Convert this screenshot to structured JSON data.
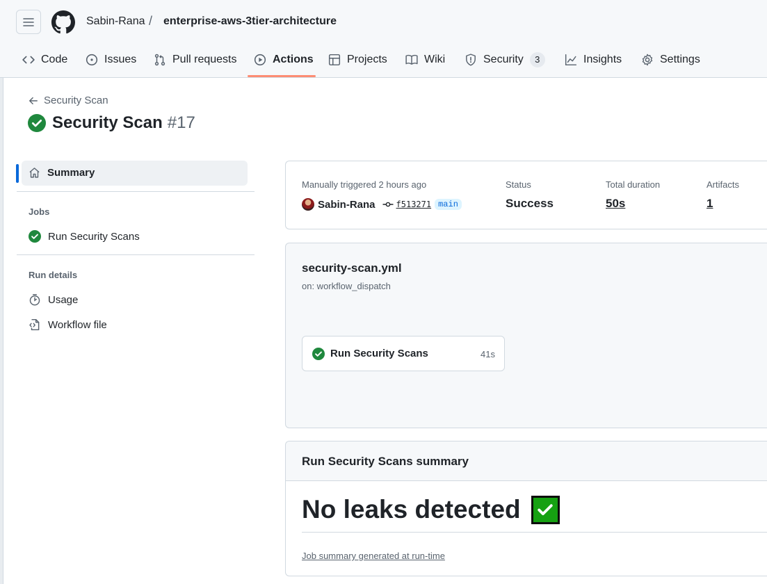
{
  "breadcrumb": {
    "owner": "Sabin-Rana",
    "separator": "/",
    "repo": "enterprise-aws-3tier-architecture"
  },
  "nav": {
    "tabs": [
      {
        "label": "Code",
        "icon": "code-icon"
      },
      {
        "label": "Issues",
        "icon": "issue-icon"
      },
      {
        "label": "Pull requests",
        "icon": "pull-request-icon"
      },
      {
        "label": "Actions",
        "icon": "play-icon",
        "active": true
      },
      {
        "label": "Projects",
        "icon": "table-icon"
      },
      {
        "label": "Wiki",
        "icon": "book-icon"
      },
      {
        "label": "Security",
        "icon": "shield-icon",
        "count": "3"
      },
      {
        "label": "Insights",
        "icon": "graph-icon"
      },
      {
        "label": "Settings",
        "icon": "gear-icon"
      }
    ]
  },
  "run": {
    "back_label": "Security Scan",
    "workflow_name": "Security Scan",
    "number": "#17"
  },
  "sidebar": {
    "summary_label": "Summary",
    "jobs_heading": "Jobs",
    "jobs": [
      {
        "label": "Run Security Scans"
      }
    ],
    "run_details_heading": "Run details",
    "details": [
      {
        "label": "Usage",
        "icon": "stopwatch-icon"
      },
      {
        "label": "Workflow file",
        "icon": "file-code-icon"
      }
    ]
  },
  "meta": {
    "trigger_text": "Manually triggered 2 hours ago",
    "actor": "Sabin-Rana",
    "commit_sha": "f513271",
    "branch": "main",
    "status_label": "Status",
    "status_value": "Success",
    "duration_label": "Total duration",
    "duration_value": "50s",
    "artifacts_label": "Artifacts",
    "artifacts_value": "1"
  },
  "workflow": {
    "file": "security-scan.yml",
    "trigger": "on: workflow_dispatch",
    "job": {
      "name": "Run Security Scans",
      "duration": "41s"
    }
  },
  "job_summary": {
    "title": "Run Security Scans summary",
    "heading": "No leaks detected",
    "footer": "Job summary generated at run-time"
  },
  "colors": {
    "success": "#1f883d",
    "accent": "#0969da",
    "active_tab_underline": "#fd8c73"
  }
}
